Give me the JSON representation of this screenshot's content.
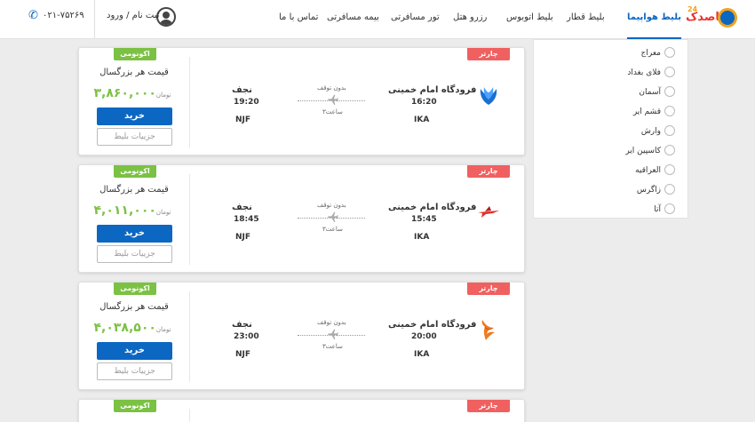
{
  "header": {
    "logo_text": "قاصدک",
    "logo_number": "24",
    "nav": [
      {
        "label": "بلیط هواپیما",
        "active": true
      },
      {
        "label": "بلیط قطار",
        "active": false
      },
      {
        "label": "بلیط اتوبوس",
        "active": false
      },
      {
        "label": "رزرو هتل",
        "active": false
      },
      {
        "label": "تور مسافرتی",
        "active": false
      },
      {
        "label": "بیمه مسافرتی",
        "active": false
      },
      {
        "label": "تماس با ما",
        "active": false
      }
    ],
    "login_label": "ثبت نام / ورود",
    "phone": "۰۲۱-۷۵۲۶۹"
  },
  "filter": {
    "airlines": [
      "معراج",
      "فلای بغداد",
      "آسمان",
      "قشم ایر",
      "وارش",
      "کاسپین ایر",
      "العراقیه",
      "زاگرس",
      "آتا"
    ]
  },
  "tickets": [
    {
      "badge_charter": "چارتر",
      "badge_class": "اکونومی",
      "price_label": "قیمت هر بزرگسال",
      "price": "۳,۸۶۰,۰۰۰",
      "currency": "تومان",
      "buy_label": "خرید",
      "details_label": "جزییات بلیط",
      "destination_city": "نجف",
      "arrival_time": "19:20",
      "destination_code": "NJF",
      "stops": "بدون توقف",
      "duration": "۳ساعت",
      "origin_city": "فرودگاه امام خمینی",
      "departure_time": "16:20",
      "origin_code": "IKA",
      "airline_icon": "blue-bird-logo",
      "airline_color": "#1a6fd0"
    },
    {
      "badge_charter": "چارتر",
      "badge_class": "اکونومی",
      "price_label": "قیمت هر بزرگسال",
      "price": "۴,۰۱۱,۰۰۰",
      "currency": "تومان",
      "buy_label": "خرید",
      "details_label": "جزییات بلیط",
      "destination_city": "نجف",
      "arrival_time": "18:45",
      "destination_code": "NJF",
      "stops": "بدون توقف",
      "duration": "۳ساعت",
      "origin_city": "فرودگاه امام خمینی",
      "departure_time": "15:45",
      "origin_code": "IKA",
      "airline_icon": "red-plane-logo",
      "airline_color": "#e0302c"
    },
    {
      "badge_charter": "چارتر",
      "badge_class": "اکونومی",
      "price_label": "قیمت هر بزرگسال",
      "price": "۴,۰۳۸,۵۰۰",
      "currency": "تومان",
      "buy_label": "خرید",
      "details_label": "جزییات بلیط",
      "destination_city": "نجف",
      "arrival_time": "23:00",
      "destination_code": "NJF",
      "stops": "بدون توقف",
      "duration": "۳ساعت",
      "origin_city": "فرودگاه امام خمینی",
      "departure_time": "20:00",
      "origin_code": "IKA",
      "airline_icon": "orange-bird-logo",
      "airline_color": "#f07a1e"
    },
    {
      "badge_charter": "چارتر",
      "badge_class": "اکونومی"
    }
  ],
  "colors": {
    "primary": "#0b67c2",
    "economy_badge": "#7bc143",
    "charter_badge": "#f06060",
    "price": "#7bc143"
  }
}
